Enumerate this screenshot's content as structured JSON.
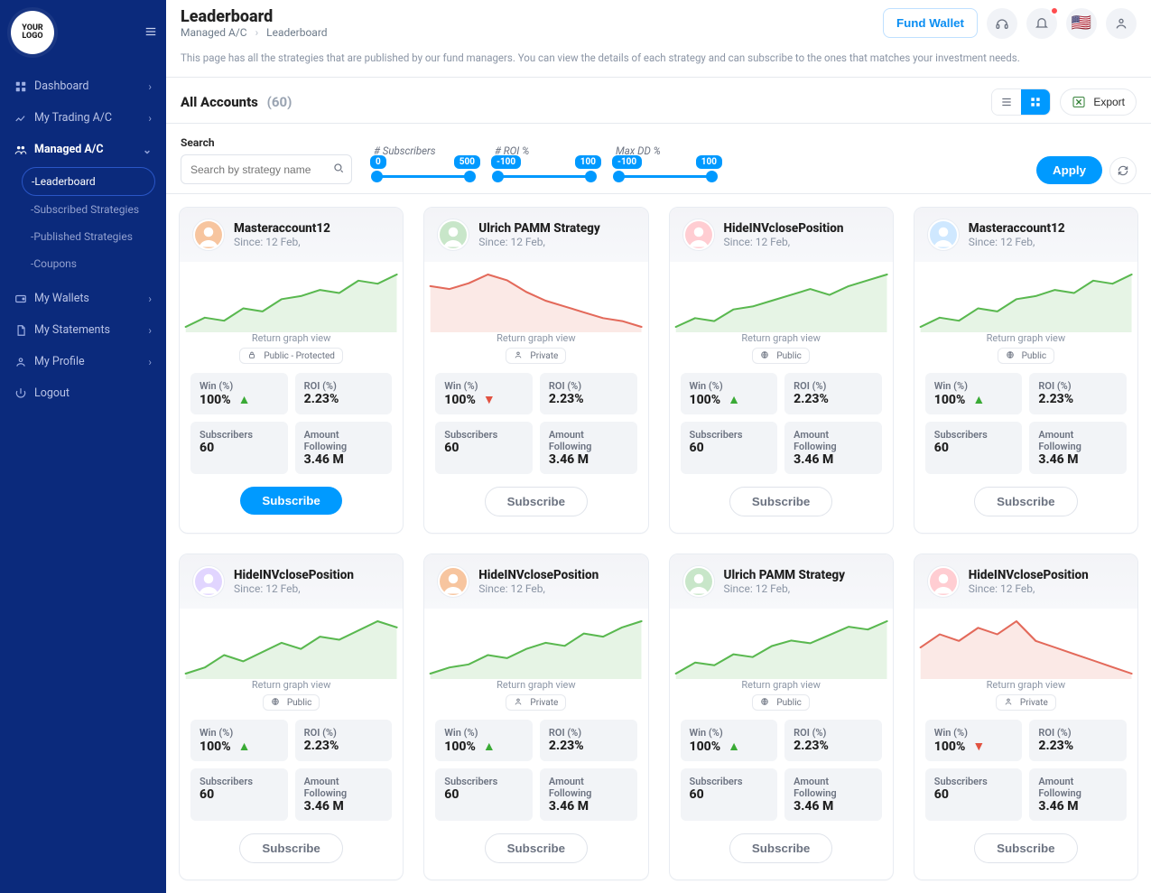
{
  "brand": {
    "line1": "YOUR",
    "line2": "LOGO"
  },
  "sidebar": {
    "items": [
      {
        "icon": "dashboard",
        "label": "Dashboard",
        "type": "group"
      },
      {
        "icon": "chart",
        "label": "My Trading A/C",
        "type": "group"
      },
      {
        "icon": "managed",
        "label": "Managed A/C",
        "type": "group",
        "activeLabel": "Managed A/C"
      },
      {
        "icon": "wallet",
        "label": "My Wallets",
        "type": "group"
      },
      {
        "icon": "doc",
        "label": "My Statements",
        "type": "group"
      },
      {
        "icon": "user",
        "label": "My Profile",
        "type": "group"
      },
      {
        "icon": "logout",
        "label": "Logout",
        "type": "single"
      }
    ],
    "managedSub": [
      {
        "label": "-Leaderboard",
        "selected": true
      },
      {
        "label": "-Subscribed Strategies"
      },
      {
        "label": "-Published Strategies"
      },
      {
        "label": "-Coupons"
      }
    ]
  },
  "header": {
    "title": "Leaderboard",
    "breadcrumb": {
      "a": "Managed A/C",
      "b": "Leaderboard"
    },
    "fundWallet": "Fund Wallet"
  },
  "subdesc": "This page has all the strategies that are published by our fund managers. You can view the details of each strategy and can subscribe to the ones that matches your investment needs.",
  "section": {
    "title": "All Accounts",
    "count": "(60)",
    "export": "Export"
  },
  "filters": {
    "searchLabel": "Search",
    "searchPlaceholder": "Search by strategy name",
    "sliders": {
      "subscribers": {
        "title": "# Subscribers",
        "min": "0",
        "max": "500"
      },
      "roi": {
        "title": "# ROI %",
        "min": "-100",
        "max": "100"
      },
      "dd": {
        "title": "Max DD %",
        "min": "-100",
        "max": "100"
      }
    },
    "apply": "Apply"
  },
  "cards": [
    {
      "name": "Masteraccount12",
      "since": "Since: 12 Feb,",
      "privacy": "Public - Protected",
      "pIcon": "lock",
      "trend": "green",
      "trendDir": "up",
      "win": "100%",
      "roi": "2.23%",
      "subs": "60",
      "amount": "3.46 M",
      "cta": "Subscribe",
      "ctaStyle": "primary"
    },
    {
      "name": "Ulrich PAMM Strategy",
      "since": "Since: 12 Feb,",
      "privacy": "Private",
      "pIcon": "user",
      "trend": "red",
      "trendDir": "down",
      "win": "100%",
      "roi": "2.23%",
      "subs": "60",
      "amount": "3.46 M",
      "cta": "Subscribe",
      "ctaStyle": "ghost"
    },
    {
      "name": "HideINVclosePosition",
      "since": "Since: 12 Feb,",
      "privacy": "Public",
      "pIcon": "globe",
      "trend": "green",
      "trendDir": "up",
      "win": "100%",
      "roi": "2.23%",
      "subs": "60",
      "amount": "3.46 M",
      "cta": "Subscribe",
      "ctaStyle": "ghost"
    },
    {
      "name": "Masteraccount12",
      "since": "Since: 12 Feb,",
      "privacy": "Public",
      "pIcon": "globe",
      "trend": "green",
      "trendDir": "up",
      "win": "100%",
      "roi": "2.23%",
      "subs": "60",
      "amount": "3.46 M",
      "cta": "Subscribe",
      "ctaStyle": "ghost"
    },
    {
      "name": "HideINVclosePosition",
      "since": "Since: 12 Feb,",
      "privacy": "Public",
      "pIcon": "globe",
      "trend": "green",
      "trendDir": "up",
      "win": "100%",
      "roi": "2.23%",
      "subs": "60",
      "amount": "3.46 M",
      "cta": "Subscribe",
      "ctaStyle": "ghost"
    },
    {
      "name": "HideINVclosePosition",
      "since": "Since: 12 Feb,",
      "privacy": "Private",
      "pIcon": "user",
      "trend": "green",
      "trendDir": "up",
      "win": "100%",
      "roi": "2.23%",
      "subs": "60",
      "amount": "3.46 M",
      "cta": "Subscribe",
      "ctaStyle": "ghost"
    },
    {
      "name": "Ulrich PAMM Strategy",
      "since": "Since: 12 Feb,",
      "privacy": "Public",
      "pIcon": "globe",
      "trend": "green",
      "trendDir": "up",
      "win": "100%",
      "roi": "2.23%",
      "subs": "60",
      "amount": "3.46 M",
      "cta": "Subscribe",
      "ctaStyle": "ghost"
    },
    {
      "name": "HideINVclosePosition",
      "since": "Since: 12 Feb,",
      "privacy": "Private",
      "pIcon": "user",
      "trend": "red",
      "trendDir": "down",
      "win": "100%",
      "roi": "2.23%",
      "subs": "60",
      "amount": "3.46 M",
      "cta": "Subscribe",
      "ctaStyle": "ghost"
    }
  ],
  "labels": {
    "returnGraph": "Return graph view",
    "winPct": "Win (%)",
    "roiPct": "ROI (%)",
    "subscribers": "Subscribers",
    "amountFollowing": "Amount Following"
  },
  "chart_data": [
    {
      "type": "line",
      "series": [
        {
          "name": "return",
          "values": [
            10,
            16,
            14,
            22,
            20,
            28,
            30,
            34,
            32,
            40,
            38,
            44
          ]
        }
      ],
      "title": "Return graph view"
    },
    {
      "type": "line",
      "series": [
        {
          "name": "return",
          "values": [
            40,
            38,
            42,
            48,
            44,
            36,
            30,
            26,
            22,
            18,
            16,
            12
          ]
        }
      ],
      "title": "Return graph view"
    },
    {
      "type": "line",
      "series": [
        {
          "name": "return",
          "values": [
            8,
            14,
            12,
            20,
            22,
            26,
            30,
            34,
            30,
            36,
            40,
            44
          ]
        }
      ],
      "title": "Return graph view"
    },
    {
      "type": "line",
      "series": [
        {
          "name": "return",
          "values": [
            10,
            16,
            14,
            22,
            20,
            28,
            30,
            34,
            32,
            40,
            38,
            44
          ]
        }
      ],
      "title": "Return graph view"
    },
    {
      "type": "line",
      "series": [
        {
          "name": "return",
          "values": [
            10,
            14,
            22,
            18,
            24,
            30,
            26,
            34,
            32,
            38,
            44,
            40
          ]
        }
      ],
      "title": "Return graph view"
    },
    {
      "type": "line",
      "series": [
        {
          "name": "return",
          "values": [
            8,
            12,
            14,
            20,
            18,
            24,
            28,
            26,
            34,
            32,
            38,
            42
          ]
        }
      ],
      "title": "Return graph view"
    },
    {
      "type": "line",
      "series": [
        {
          "name": "return",
          "values": [
            6,
            14,
            12,
            20,
            18,
            26,
            30,
            28,
            34,
            40,
            38,
            44
          ]
        }
      ],
      "title": "Return graph view"
    },
    {
      "type": "line",
      "series": [
        {
          "name": "return",
          "values": [
            26,
            30,
            28,
            32,
            30,
            34,
            28,
            26,
            24,
            22,
            20,
            18
          ]
        }
      ],
      "title": "Return graph view"
    }
  ]
}
